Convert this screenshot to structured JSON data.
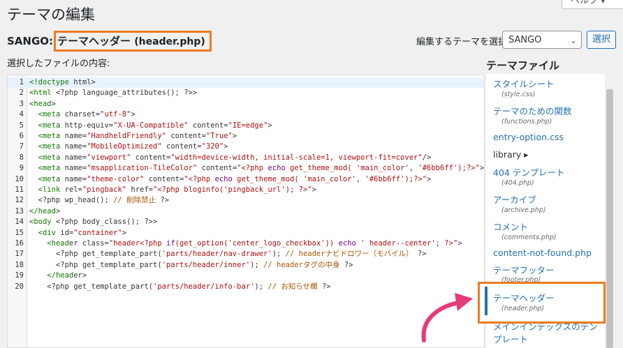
{
  "page": {
    "title": "テーマの編集",
    "help_label": "ヘルプ ▾"
  },
  "file_heading": {
    "theme": "SANGO:",
    "file_name": "テーマヘッダー",
    "file_desc": "(header.php)"
  },
  "theme_selector": {
    "label": "編集するテーマを選択:",
    "selected": "SANGO",
    "button_label": "選択"
  },
  "content_label": "選択したファイルの内容:",
  "code_lines": [
    "<!doctype html>",
    "<html <?php language_attributes(); ?>>",
    "<head>",
    "  <meta charset=\"utf-8\">",
    "  <meta http-equiv=\"X-UA-Compatible\" content=\"IE=edge\">",
    "  <meta name=\"HandheldFriendly\" content=\"True\">",
    "  <meta name=\"MobileOptimized\" content=\"320\">",
    "  <meta name=\"viewport\" content=\"width=device-width, initial-scale=1, viewport-fit=cover\"/>",
    "  <meta name=\"msapplication-TileColor\" content=\"<?php echo get_theme_mod( 'main_color', '#6bb6ff');?>\">",
    "  <meta name=\"theme-color\" content=\"<?php echo get_theme_mod( 'main_color', '#6bb6ff');?>\">",
    "  <link rel=\"pingback\" href=\"<?php bloginfo('pingback_url'); ?>\">",
    "  <?php wp_head(); // 削除禁止 ?>",
    "</head>",
    "<body <?php body_class(); ?>>",
    "  <div id=\"container\">",
    "    <header class=\"header<?php if(get_option('center_logo_checkbox')) echo ' header--center'; ?>\">",
    "      <?php get_template_part('parts/header/nav-drawer'); // headerナビドロワー（モバイル） ?>",
    "      <?php get_template_part('parts/header/inner'); // headerタグの中身 ?>",
    "    </header>",
    "    <?php get_template_part('parts/header/info-bar'); // お知らせ欄 ?>"
  ],
  "theme_files": {
    "title": "テーマファイル",
    "items": [
      {
        "label": "スタイルシート",
        "file": "(style.css)"
      },
      {
        "label": "テーマのための関数",
        "file": "(functions.php)"
      },
      {
        "label": "entry-option.css",
        "file": ""
      },
      {
        "label": "library ▸",
        "file": ""
      },
      {
        "label": "404 テンプレート",
        "file": "(404.php)"
      },
      {
        "label": "アーカイブ",
        "file": "(archive.php)"
      },
      {
        "label": "コメント",
        "file": "(comments.php)"
      },
      {
        "label": "content-not-found.php",
        "file": ""
      },
      {
        "label": "テーマフッター",
        "file": "(footer.php)"
      },
      {
        "label": "テーマヘッダー",
        "file": "(header.php)"
      },
      {
        "label": "メインインデックスのテンプレート",
        "file": ""
      }
    ]
  },
  "colors": {
    "accent": "#2271b1",
    "highlight": "#ee7a1f",
    "arrow": "#e8397b"
  }
}
